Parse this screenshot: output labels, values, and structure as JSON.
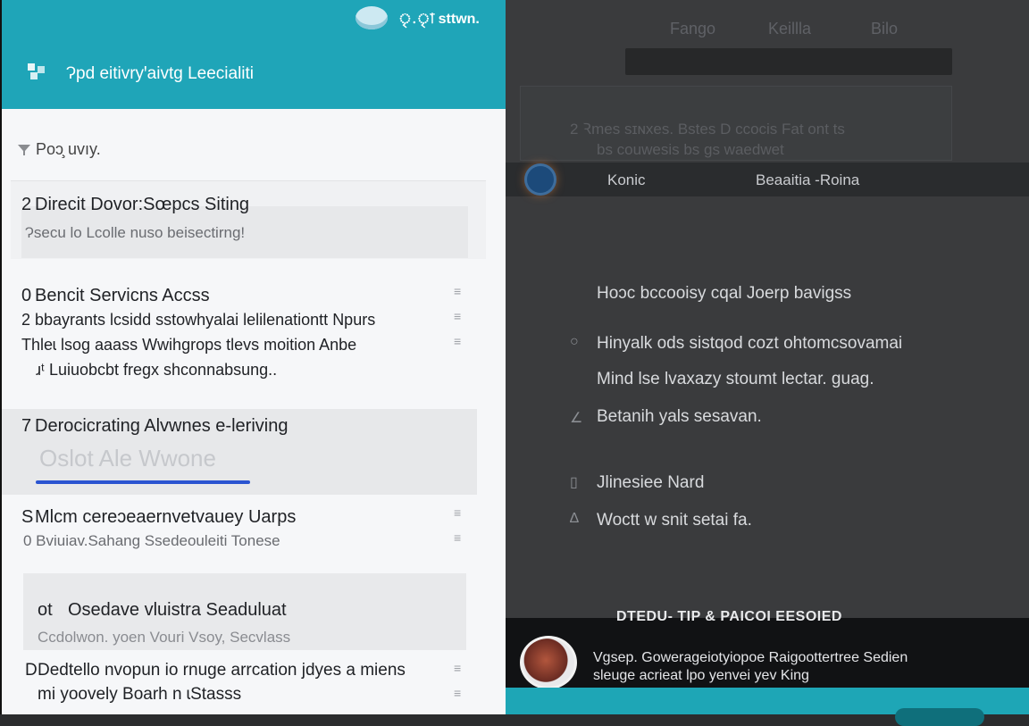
{
  "status": {
    "text": "ৃ.ৃা sttwn."
  },
  "header": {
    "title": "Ɂpd eitivryꞌaivtg Leecialiti"
  },
  "sort": {
    "label": "Poɔ̧ uvıy."
  },
  "list": [
    {
      "index": "2",
      "title": "Direcit Dovor:Sœpcs Siting",
      "sub": "Ɂsecu lo Lcolle nuso beisectirng!"
    },
    {
      "index": "0",
      "title": "Bencit Servicns Accss",
      "lines": [
        "2 bbayrants lcsidd sstowhyalai lelilenationtt Npurs",
        "Thleɩ lsog aaass Wwihgrops tlevs moition Anbe",
        "ɹᵗ Luiuobcbt fregx shconnabsung.."
      ]
    },
    {
      "index": "7",
      "title": "Derocicrating Alvwnes e-leriving",
      "sub": "Oslot  Ale  Wwone",
      "progress": 0.45
    },
    {
      "index": "S",
      "title": "Mlcm cereɔeaernvetvauey Uarps",
      "sub": "0 Bviuiav.Sahang Ssedeouleiti  Tonese"
    },
    {
      "index": "ot",
      "title": "Osedave vluistra Seaduluat",
      "sub": "Ccdolwon. yoen Vouri Vsoy, Secvlass"
    },
    {
      "index": "D",
      "title": "Dedtello nvopun io rnuge arrcation jdyes a miens",
      "sub": "mi yoovely Boarh n  ɩStasss"
    }
  ],
  "right": {
    "tabs": [
      "Fango",
      "Keillla",
      "Bilo"
    ],
    "ghost_lines": [
      "2   Ꝛmes  sɪɴxes.  Bstes   D   ccocis  Fat  ont  ts",
      "bs  couwesis   bs   gs  waedwet"
    ],
    "row": {
      "left": "Konic",
      "right": "Beaaitia -Roina"
    },
    "body_lines": [
      {
        "mark": "",
        "text": "Hoɔc bccooisy cqal Joerp bavigss"
      },
      {
        "mark": "○",
        "text": "Hinyalk ods sistqod cozt ohtomcsovamai"
      },
      {
        "mark": "",
        "text": "Mind lse lvaxazy stoumt lectar. guag."
      },
      {
        "mark": "∠",
        "text": "Betanih yals sesavan."
      },
      {
        "mark": "▯",
        "text": "Jlinesiee Nard"
      },
      {
        "mark": "∆",
        "text": "Woctt w snit setai fa."
      }
    ],
    "banner": {
      "title": "DTEDU- TIP & PAICOI EESOIED",
      "lines": [
        "Vgsep.  Gowerageiotyiopoe Raigoottertree Sedien",
        "sleuge acrieat lpo yenvei yev King"
      ]
    }
  },
  "colors": {
    "teal": "#1fa5b8",
    "progress_blue": "#2a54d1",
    "right_bg": "#3a3b3d",
    "banner_bg": "#111214"
  }
}
